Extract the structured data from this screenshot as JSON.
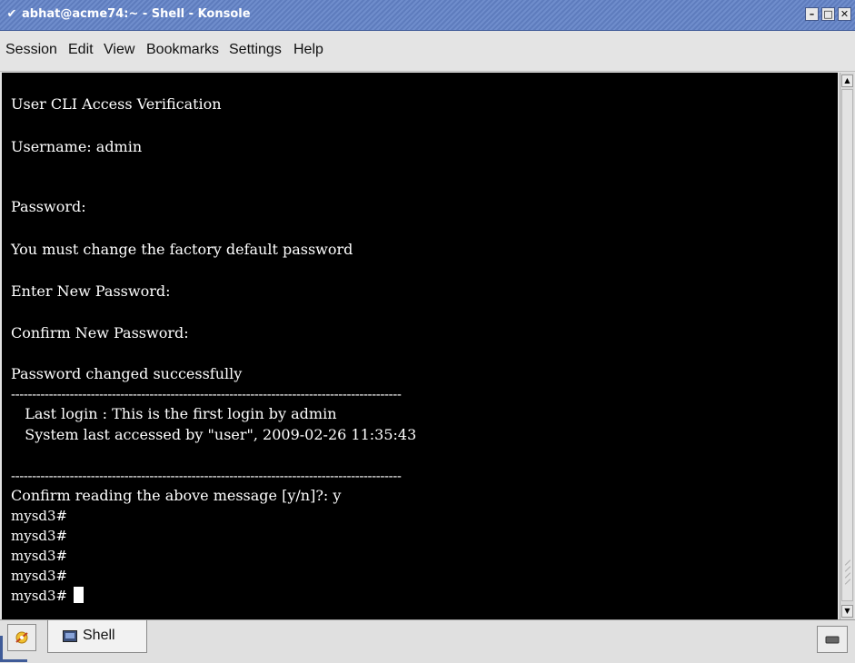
{
  "window": {
    "title": "abhat@acme74:~ - Shell - Konsole",
    "menu_icon": "chevron-down-icon",
    "buttons": [
      "minimize-icon",
      "maximize-icon",
      "close-icon"
    ]
  },
  "menubar": {
    "items": [
      "Session",
      "Edit",
      "View",
      "Bookmarks",
      "Settings",
      "Help"
    ]
  },
  "terminal": {
    "lines": [
      "User CLI Access Verification",
      "Username: admin",
      "Password:",
      "You must change the factory default password",
      "Enter New Password:",
      "Confirm New Password:",
      "Password changed successfully",
      "---------------------------------------------------------------------------------------------",
      "   Last login : This is the first login by admin",
      "   System last accessed by \"user\", 2009-02-26 11:35:43",
      "---------------------------------------------------------------------------------------------",
      "Confirm reading the above message [y/n]?: y",
      "mysd3#",
      "mysd3#",
      "mysd3#",
      "mysd3#",
      "mysd3# "
    ]
  },
  "tabs": {
    "items": [
      {
        "label": "Shell",
        "icon": "terminal-icon"
      }
    ],
    "new_tab_icon": "new-session-icon",
    "close_tab_icon": "close-session-icon"
  },
  "colors": {
    "terminal_bg": "#000000",
    "terminal_fg": "#ffffff",
    "titlebar": "#6f8dcc"
  }
}
